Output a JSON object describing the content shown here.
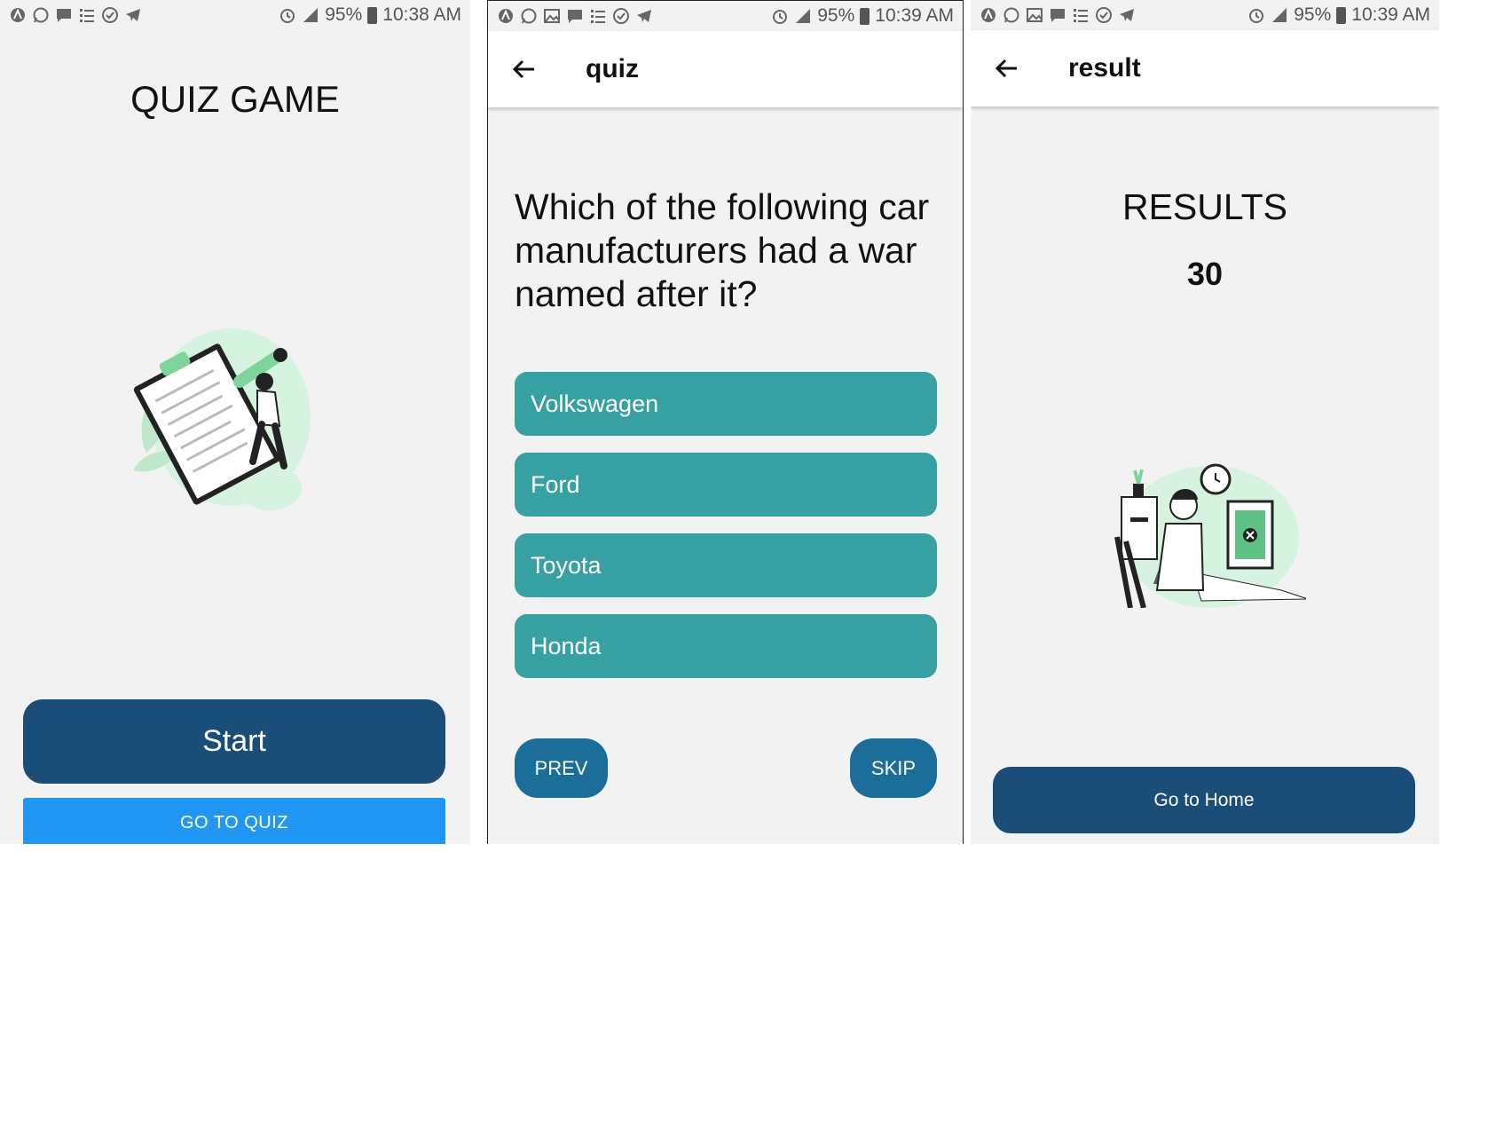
{
  "status_icons": [
    "android-icon",
    "whatsapp-icon",
    "chat-icon",
    "list-icon",
    "check-circle-icon",
    "telegram-icon"
  ],
  "status_icons_with_gallery": [
    "android-icon",
    "whatsapp-icon",
    "gallery-icon",
    "chat-icon",
    "list-icon",
    "check-circle-icon",
    "telegram-icon"
  ],
  "screens": {
    "home": {
      "status": {
        "battery": "95%",
        "time": "10:38 AM"
      },
      "title": "QUIZ GAME",
      "start_label": "Start",
      "goquiz_label": "GO TO QUIZ"
    },
    "quiz": {
      "status": {
        "battery": "95%",
        "time": "10:39 AM"
      },
      "appbar_title": "quiz",
      "question": "Which of the following car manufacturers had a war named after it?",
      "options": [
        "Volkswagen",
        "Ford",
        "Toyota",
        "Honda"
      ],
      "prev_label": "PREV",
      "skip_label": "SKIP"
    },
    "result": {
      "status": {
        "battery": "95%",
        "time": "10:39 AM"
      },
      "appbar_title": "result",
      "heading": "RESULTS",
      "score": "30",
      "home_label": "Go to Home"
    }
  },
  "colors": {
    "primary_dark": "#1a4d78",
    "primary_blue": "#2196f3",
    "option_teal": "#36a0a2",
    "nav_button": "#1b6e9a",
    "screen_bg": "#f2f2f2",
    "illustration_green": "#c9efd6"
  }
}
